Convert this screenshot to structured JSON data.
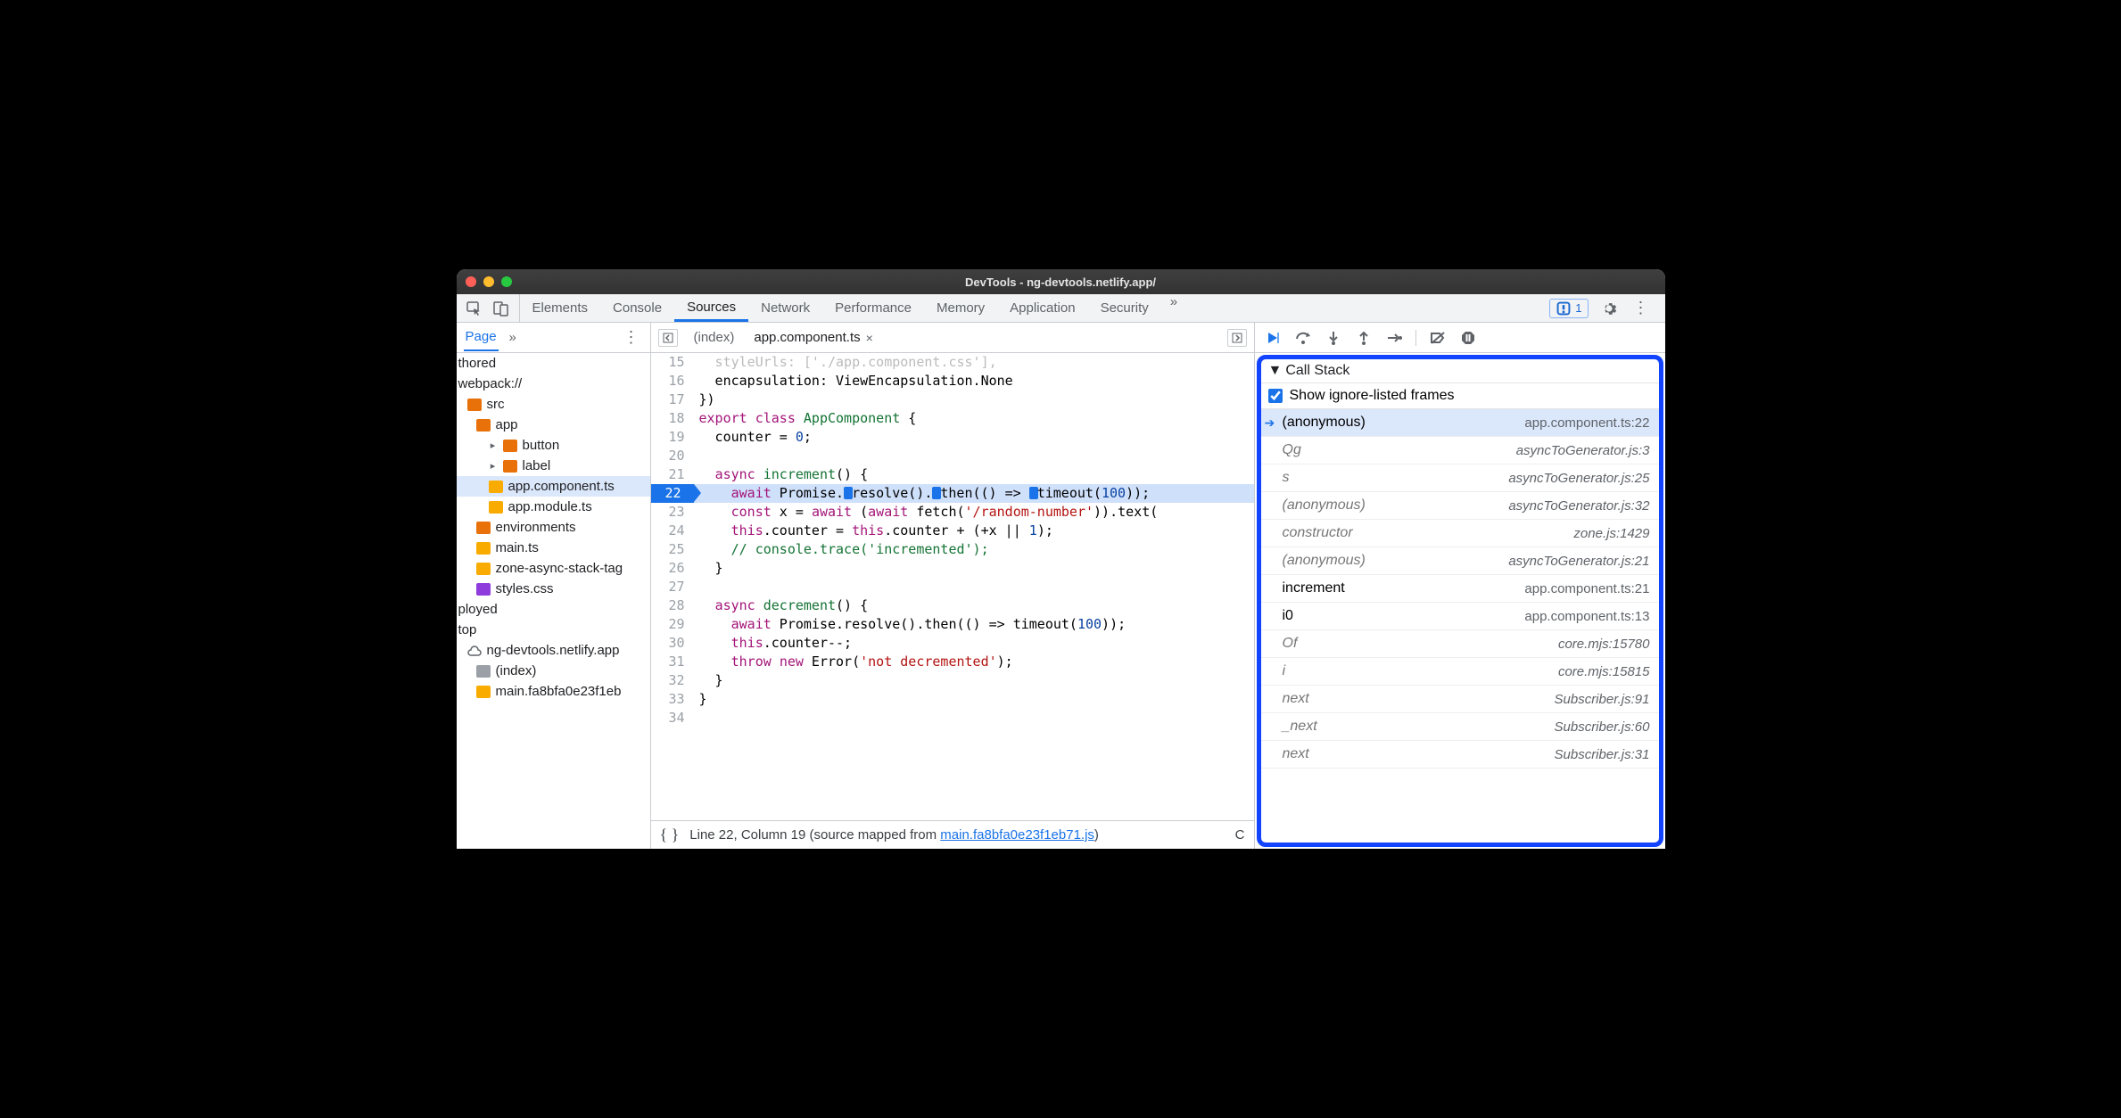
{
  "titlebar": {
    "title": "DevTools - ng-devtools.netlify.app/"
  },
  "tabs": {
    "items": [
      "Elements",
      "Console",
      "Sources",
      "Network",
      "Performance",
      "Memory",
      "Application",
      "Security"
    ],
    "active": "Sources",
    "issues_count": "1"
  },
  "navigator": {
    "tab_label": "Page",
    "tree": [
      {
        "indent": 0,
        "label": "thored",
        "icon": "none"
      },
      {
        "indent": 0,
        "label": "webpack://",
        "icon": "none"
      },
      {
        "indent": 1,
        "label": "src",
        "icon": "f-orange"
      },
      {
        "indent": 2,
        "label": "app",
        "icon": "f-orange"
      },
      {
        "indent": 3,
        "label": "button",
        "icon": "f-orange",
        "exp": true
      },
      {
        "indent": 3,
        "label": "label",
        "icon": "f-orange",
        "exp": true
      },
      {
        "indent": 3,
        "label": "app.component.ts",
        "icon": "f-yellow",
        "sel": true
      },
      {
        "indent": 3,
        "label": "app.module.ts",
        "icon": "f-yellow"
      },
      {
        "indent": 2,
        "label": "environments",
        "icon": "f-orange"
      },
      {
        "indent": 2,
        "label": "main.ts",
        "icon": "f-yellow"
      },
      {
        "indent": 2,
        "label": "zone-async-stack-tag",
        "icon": "f-yellow"
      },
      {
        "indent": 2,
        "label": "styles.css",
        "icon": "f-purple"
      },
      {
        "indent": 0,
        "label": "ployed",
        "icon": "none"
      },
      {
        "indent": 0,
        "label": "top",
        "icon": "none"
      },
      {
        "indent": 1,
        "label": "ng-devtools.netlify.app",
        "icon": "cloud"
      },
      {
        "indent": 2,
        "label": "(index)",
        "icon": "f-file"
      },
      {
        "indent": 2,
        "label": "main.fa8bfa0e23f1eb",
        "icon": "f-yellow"
      }
    ]
  },
  "filetabs": {
    "items": [
      {
        "label": "(index)",
        "active": false,
        "closable": false
      },
      {
        "label": "app.component.ts",
        "active": true,
        "closable": true
      }
    ]
  },
  "editor": {
    "lines": [
      {
        "n": 15,
        "raw": "  styleUrls: ['./app.component.css'],",
        "faded": true
      },
      {
        "n": 16,
        "raw": "  encapsulation: ViewEncapsulation.None"
      },
      {
        "n": 17,
        "raw": "})"
      },
      {
        "n": 18,
        "raw": "export class AppComponent {",
        "tokens": [
          [
            "kw",
            "export"
          ],
          [
            "",
            " "
          ],
          [
            "kw",
            "class"
          ],
          [
            "",
            " "
          ],
          [
            "type",
            "AppComponent"
          ],
          [
            "",
            " {"
          ]
        ]
      },
      {
        "n": 19,
        "raw": "  counter = 0;",
        "tokens": [
          [
            "",
            "  counter = "
          ],
          [
            "num",
            "0"
          ],
          [
            "",
            ";"
          ]
        ]
      },
      {
        "n": 20,
        "raw": ""
      },
      {
        "n": 21,
        "raw": "  async increment() {",
        "tokens": [
          [
            "",
            "  "
          ],
          [
            "kw",
            "async"
          ],
          [
            "",
            " "
          ],
          [
            "type",
            "increment"
          ],
          [
            "",
            "() {"
          ]
        ]
      },
      {
        "n": 22,
        "raw": "    await Promise.resolve().then(() => timeout(100));",
        "hl": true,
        "tokens": [
          [
            "",
            "    "
          ],
          [
            "kw",
            "await"
          ],
          [
            "",
            " Promise."
          ],
          [
            "bp",
            ""
          ],
          [
            "",
            "resolve()."
          ],
          [
            "bp",
            ""
          ],
          [
            "",
            "then(() => "
          ],
          [
            "bp",
            ""
          ],
          [
            "",
            "timeout("
          ],
          [
            "num",
            "100"
          ],
          [
            "",
            "));"
          ]
        ]
      },
      {
        "n": 23,
        "raw": "    const x = await (await fetch('/random-number')).text(",
        "tokens": [
          [
            "",
            "    "
          ],
          [
            "kw",
            "const"
          ],
          [
            "",
            " x = "
          ],
          [
            "kw",
            "await"
          ],
          [
            "",
            " ("
          ],
          [
            "kw",
            "await"
          ],
          [
            "",
            " fetch("
          ],
          [
            "str",
            "'/random-number'"
          ],
          [
            "",
            ")).text("
          ]
        ]
      },
      {
        "n": 24,
        "raw": "    this.counter = this.counter + (+x || 1);",
        "tokens": [
          [
            "",
            "    "
          ],
          [
            "kw",
            "this"
          ],
          [
            "",
            ".counter = "
          ],
          [
            "kw",
            "this"
          ],
          [
            "",
            ".counter + (+x || "
          ],
          [
            "num",
            "1"
          ],
          [
            "",
            ");"
          ]
        ]
      },
      {
        "n": 25,
        "raw": "    // console.trace('incremented');",
        "tokens": [
          [
            "comment",
            "    // console.trace('incremented');"
          ]
        ]
      },
      {
        "n": 26,
        "raw": "  }"
      },
      {
        "n": 27,
        "raw": ""
      },
      {
        "n": 28,
        "raw": "  async decrement() {",
        "tokens": [
          [
            "",
            "  "
          ],
          [
            "kw",
            "async"
          ],
          [
            "",
            " "
          ],
          [
            "type",
            "decrement"
          ],
          [
            "",
            "() {"
          ]
        ]
      },
      {
        "n": 29,
        "raw": "    await Promise.resolve().then(() => timeout(100));",
        "tokens": [
          [
            "",
            "    "
          ],
          [
            "kw",
            "await"
          ],
          [
            "",
            " Promise.resolve().then(() => timeout("
          ],
          [
            "num",
            "100"
          ],
          [
            "",
            "));"
          ]
        ]
      },
      {
        "n": 30,
        "raw": "    this.counter--;",
        "tokens": [
          [
            "",
            "    "
          ],
          [
            "kw",
            "this"
          ],
          [
            "",
            ".counter--;"
          ]
        ]
      },
      {
        "n": 31,
        "raw": "    throw new Error('not decremented');",
        "tokens": [
          [
            "",
            "    "
          ],
          [
            "kw",
            "throw"
          ],
          [
            "",
            " "
          ],
          [
            "kw",
            "new"
          ],
          [
            "",
            " Error("
          ],
          [
            "str",
            "'not decremented'"
          ],
          [
            "",
            ");"
          ]
        ]
      },
      {
        "n": 32,
        "raw": "  }"
      },
      {
        "n": 33,
        "raw": "}"
      },
      {
        "n": 34,
        "raw": ""
      }
    ],
    "status": {
      "cursor": "Line 22, Column 19",
      "mapped_prefix": "(source mapped from ",
      "mapped_link": "main.fa8bfa0e23f1eb71.js",
      "mapped_suffix": ")",
      "coverage": "C"
    }
  },
  "callstack": {
    "title": "Call Stack",
    "checkbox_label": "Show ignore-listed frames",
    "checkbox_checked": true,
    "frames": [
      {
        "fn": "(anonymous)",
        "loc": "app.component.ts:22",
        "sel": true
      },
      {
        "fn": "Qg",
        "loc": "asyncToGenerator.js:3",
        "ign": true
      },
      {
        "fn": "s",
        "loc": "asyncToGenerator.js:25",
        "ign": true
      },
      {
        "fn": "(anonymous)",
        "loc": "asyncToGenerator.js:32",
        "ign": true
      },
      {
        "fn": "constructor",
        "loc": "zone.js:1429",
        "ign": true
      },
      {
        "fn": "(anonymous)",
        "loc": "asyncToGenerator.js:21",
        "ign": true
      },
      {
        "fn": "increment",
        "loc": "app.component.ts:21"
      },
      {
        "fn": "i0",
        "loc": "app.component.ts:13"
      },
      {
        "fn": "Of",
        "loc": "core.mjs:15780",
        "ign": true
      },
      {
        "fn": "i",
        "loc": "core.mjs:15815",
        "ign": true
      },
      {
        "fn": "next",
        "loc": "Subscriber.js:91",
        "ign": true
      },
      {
        "fn": "_next",
        "loc": "Subscriber.js:60",
        "ign": true
      },
      {
        "fn": "next",
        "loc": "Subscriber.js:31",
        "ign": true
      }
    ]
  }
}
